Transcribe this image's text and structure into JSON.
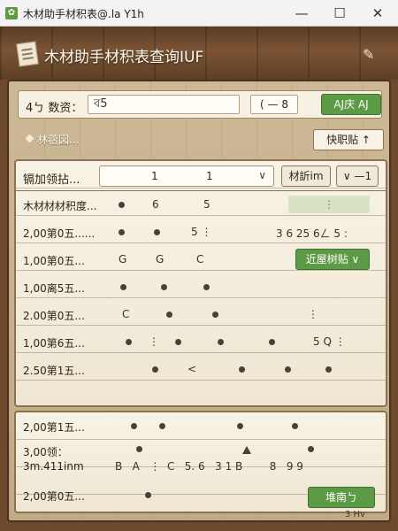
{
  "window": {
    "title": "木材助手材积表@.la Y1h",
    "min": "—",
    "max": "☐",
    "close": "✕"
  },
  "header": {
    "title": "木材助手材积表查询IUF",
    "pin_glyph": "✎"
  },
  "toolbar": {
    "count_label": "4ㄅ 数资：",
    "count_value": "ব5",
    "step_value": "( — 8",
    "calc_label": "AJ庆 AJ"
  },
  "section": {
    "label": "林蓿図...",
    "quick_label": "快职贴 ↑"
  },
  "table": {
    "head_label": "镉加领拈...",
    "select_v1": "1",
    "select_v2": "1",
    "unit_label": "材訢im",
    "minus_label": "∨ —1",
    "rows": [
      {
        "label": "木材材材积度...",
        "cells": [
          "6",
          "5"
        ],
        "light": "⋮"
      },
      {
        "label": "2,00第0五......",
        "cells": [
          "5 ⋮",
          "3 6  25 6ㄥ 5 :"
        ]
      },
      {
        "label": "1,00第0五...",
        "cells": [
          "G",
          "G",
          "C"
        ],
        "button": "近屋树贴 ∨"
      },
      {
        "label": "1,00离5五...",
        "cells": []
      },
      {
        "label": "2.00第0五...",
        "cells": [
          "C",
          "⋮"
        ]
      },
      {
        "label": "1,00第6五...",
        "cells": [
          "⋮",
          "5  Q ⋮"
        ]
      },
      {
        "label": "2.50第1五...",
        "cells": [
          "<"
        ]
      }
    ]
  },
  "bottom": {
    "row1_label": "2,00第1五...",
    "row2_label": "3,00领：",
    "row2_sub": "3m.411inm",
    "row2_values": "B   A   ⋮  C   5. 6   3 1 B        8   9 9",
    "row3_label": "2,00第0五...",
    "update_label": "堆南ㄅ",
    "status": "3 Hv"
  }
}
